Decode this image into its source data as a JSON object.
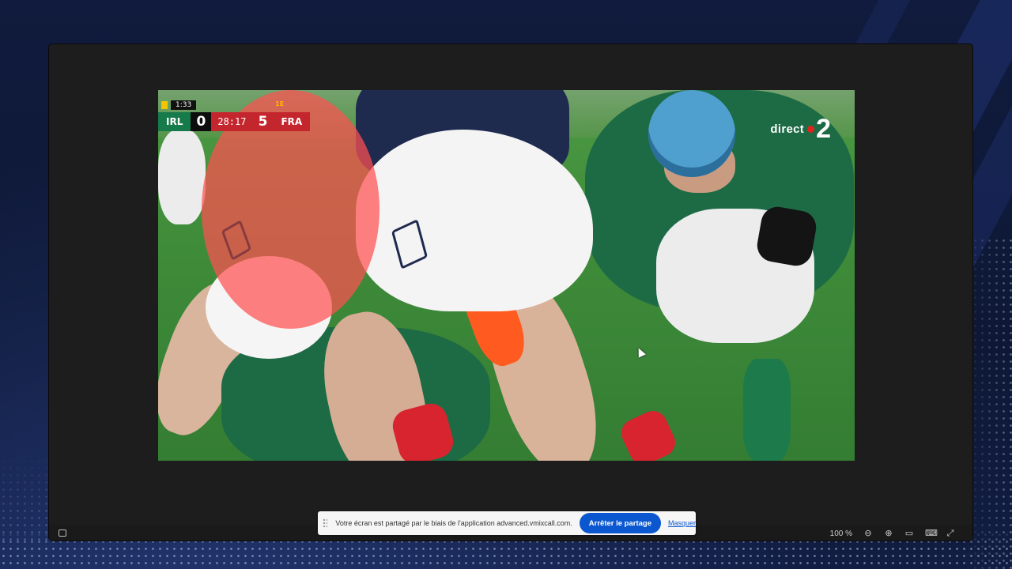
{
  "video": {
    "scoreboard": {
      "clock": "1:33",
      "team_home": "IRL",
      "score_home": "0",
      "match_time": "28:17",
      "score_away": "5",
      "team_away": "FRA",
      "tag": "1E"
    },
    "channel": {
      "word": "direct",
      "number": "2"
    }
  },
  "window": {
    "zoom_level": "100 %"
  },
  "share_bar": {
    "message": "Votre écran est partagé par le biais de l'application advanced.vmixcall.com.",
    "stop_label": "Arrêter le partage",
    "hide_label": "Masquer"
  },
  "colors": {
    "share_button": "#0b57d0",
    "irl_green": "#177a4a",
    "fra_red": "#c4262e",
    "background": "#0f1a3a"
  }
}
